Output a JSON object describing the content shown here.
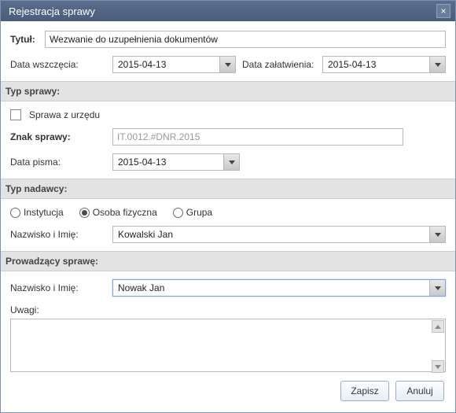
{
  "window": {
    "title": "Rejestracja sprawy",
    "close": "×"
  },
  "fields": {
    "title_label": "Tytuł:",
    "title_value": "Wezwanie do uzupełnienia dokumentów",
    "start_date_label": "Data wszczęcia:",
    "start_date_value": "2015-04-13",
    "resolve_date_label": "Data załatwienia:",
    "resolve_date_value": "2015-04-13",
    "section_type": "Typ sprawy:",
    "office_case_label": "Sprawa z urzędu",
    "sign_label": "Znak sprawy:",
    "sign_value": "IT.0012.#DNR.2015",
    "letter_date_label": "Data pisma:",
    "letter_date_value": "2015-04-13",
    "section_sender": "Typ nadawcy:",
    "radio_institution": "Instytucja",
    "radio_person": "Osoba fizyczna",
    "radio_group": "Grupa",
    "sender_name_label": "Nazwisko i Imię:",
    "sender_name_value": "Kowalski Jan",
    "section_handler": "Prowadzący sprawę:",
    "handler_name_label": "Nazwisko i Imię:",
    "handler_name_value": "Nowak Jan",
    "notes_label": "Uwagi:",
    "notes_value": ""
  },
  "buttons": {
    "save": "Zapisz",
    "cancel": "Anuluj"
  },
  "sender_type_selected": "person"
}
